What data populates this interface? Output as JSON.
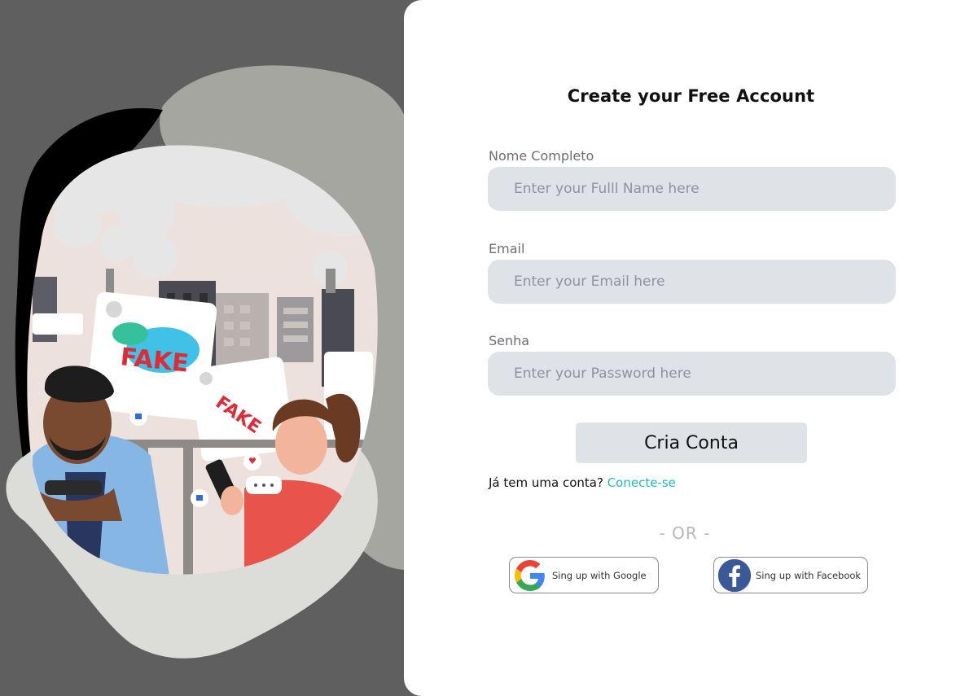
{
  "form": {
    "title": "Create your Free Account",
    "fields": [
      {
        "label": "Nome Completo",
        "placeholder": "Enter your Fulll Name here",
        "value": ""
      },
      {
        "label": "Email",
        "placeholder": "Enter your Email here",
        "value": ""
      },
      {
        "label": "Senha",
        "placeholder": "Enter your Password here",
        "value": ""
      }
    ],
    "submit_label": "Cria Conta",
    "login_prompt": "Já tem uma conta?",
    "login_link": "Conecte-se",
    "divider": "- OR -"
  },
  "social": {
    "google": {
      "label": "Sing up with Google",
      "icon": "google-icon"
    },
    "facebook": {
      "label": "Sing up with Facebook",
      "icon": "facebook-icon"
    }
  },
  "illustration": {
    "sign_text_1": "FAKE",
    "sign_text_2": "FAKE"
  },
  "colors": {
    "background": "#5f5f5f",
    "panel": "#ffffff",
    "input_bg": "#dfe2e6",
    "link": "#1fb9c4",
    "fake_red": "#e02a35",
    "facebook_blue": "#3b5998"
  }
}
